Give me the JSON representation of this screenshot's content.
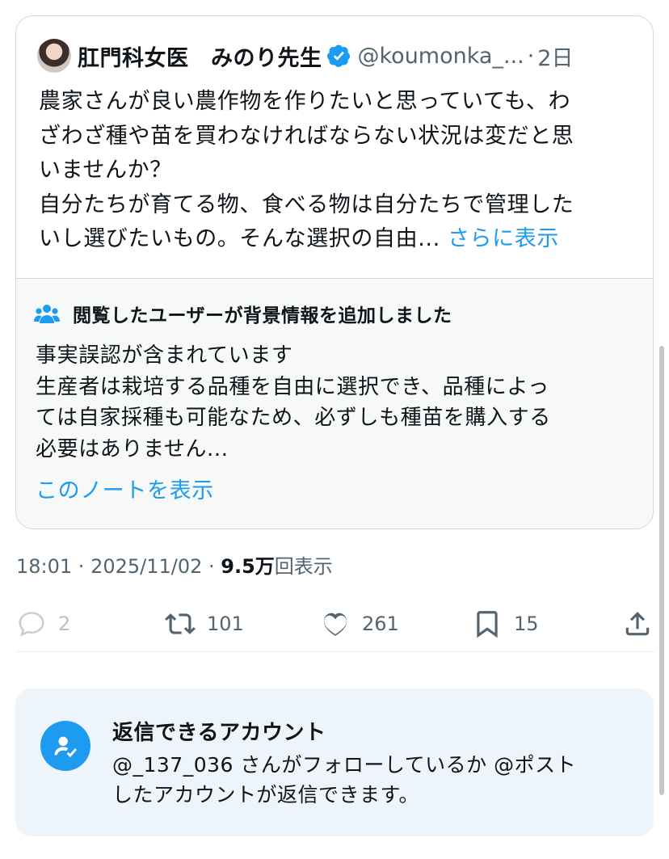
{
  "quote": {
    "display_name": "肛門科女医　みのり先生",
    "handle": "@koumonka_...",
    "separator": "·",
    "time": "2日",
    "body_lines": [
      "農家さんが良い農作物を作りたいと思っていても、わ",
      "ざわざ種や苗を買わなければならない状況は変だと思",
      "いませんか？",
      "自分たちが育てる物、食べる物は自分たちで管理した"
    ],
    "last_line": "いし選びたいもの。そんな選択の自由...",
    "show_more": "さらに表示"
  },
  "note": {
    "title": "閲覧したユーザーが背景情報を追加しました",
    "body_lines": [
      "事実誤認が含まれています",
      "生産者は栽培する品種を自由に選択でき、品種によっ",
      "ては自家採種も可能なため、必ずしも種苗を購入する",
      "必要はありません..."
    ],
    "link": "このノートを表示"
  },
  "meta": {
    "time": "18:01",
    "sep1": " · ",
    "date": "2025/11/02",
    "sep2": " · ",
    "views": "9.5万",
    "views_label": "回表示"
  },
  "actions": {
    "reply": {
      "icon": "reply-icon",
      "count": "2"
    },
    "retweet": {
      "icon": "retweet-icon",
      "count": "101"
    },
    "like": {
      "icon": "heart-icon",
      "count": "261"
    },
    "bookmark": {
      "icon": "bookmark-icon",
      "count": "15"
    },
    "share": {
      "icon": "share-icon"
    }
  },
  "reply_restriction": {
    "title": "返信できるアカウント",
    "lines": [
      "@_137_036 さんがフォローしているか @ポスト",
      "したアカウントが返信できます。"
    ]
  },
  "colors": {
    "accent": "#1d9bf0",
    "text": "#0f1419",
    "secondary": "#536471",
    "note_bg": "#f7f9f9",
    "reply_bg": "#edf4fa"
  }
}
